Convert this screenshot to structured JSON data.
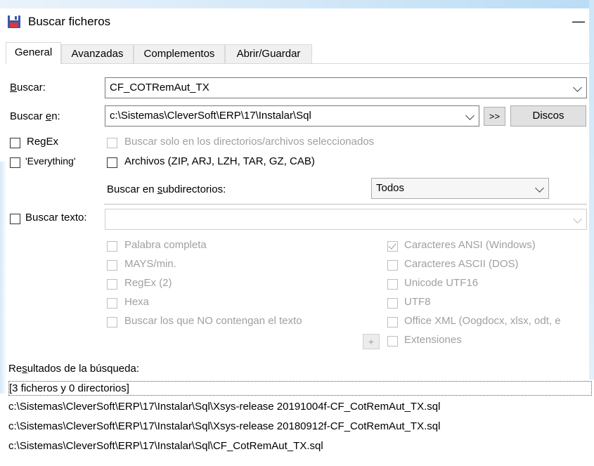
{
  "window": {
    "title": "Buscar ficheros",
    "minimize_symbol": "—"
  },
  "tabs": [
    {
      "label": "General",
      "active": true
    },
    {
      "label": "Avanzadas",
      "active": false
    },
    {
      "label": "Complementos",
      "active": false
    },
    {
      "label": "Abrir/Guardar",
      "active": false
    }
  ],
  "search": {
    "label_prefix": "B",
    "label_rest": "uscar:",
    "value": "CF_COTRemAut_TX"
  },
  "search_in": {
    "label_prefix": "Buscar ",
    "label_u": "e",
    "label_rest": "n:",
    "value": "c:\\Sistemas\\CleverSoft\\ERP\\17\\Instalar\\Sql",
    "more_button": ">>",
    "drives_button": "Discos"
  },
  "options": {
    "regex": "RegEx",
    "everything": "'Everything'",
    "only_selected": "Buscar solo en los directorios/archivos seleccionados",
    "archives": "Archivos (ZIP, ARJ, LZH, TAR, GZ, CAB)",
    "subdirs_label_prefix": "Buscar en ",
    "subdirs_label_u": "s",
    "subdirs_label_rest": "ubdirectorios:",
    "subdirs_value": "Todos"
  },
  "text_search": {
    "label": "Buscar texto:",
    "value": ""
  },
  "text_options_left": [
    "Palabra completa",
    "MAYS/min.",
    "RegEx (2)",
    "Hexa",
    "Buscar los que NO contengan el texto"
  ],
  "text_options_right": [
    {
      "label": "Caracteres ANSI (Windows)",
      "checked": true
    },
    {
      "label": "Caracteres ASCII (DOS)",
      "checked": false
    },
    {
      "label": "Unicode UTF16",
      "checked": false
    },
    {
      "label": "UTF8",
      "checked": false
    },
    {
      "label": "Office XML (Oogdocx, xlsx, odt, e",
      "checked": false
    },
    {
      "label": "Extensiones",
      "checked": false
    }
  ],
  "plus_button": "+",
  "results": {
    "label_prefix": "Re",
    "label_u": "s",
    "label_rest": "ultados de la búsqueda:",
    "rows": [
      "[3 ficheros y 0 directorios]",
      "c:\\Sistemas\\CleverSoft\\ERP\\17\\Instalar\\Sql\\Xsys-release 20191004f-CF_CotRemAut_TX.sql",
      "c:\\Sistemas\\CleverSoft\\ERP\\17\\Instalar\\Sql\\Xsys-release 20180912f-CF_CotRemAut_TX.sql",
      "c:\\Sistemas\\CleverSoft\\ERP\\17\\Instalar\\Sql\\CF_CotRemAut_TX.sql"
    ]
  }
}
